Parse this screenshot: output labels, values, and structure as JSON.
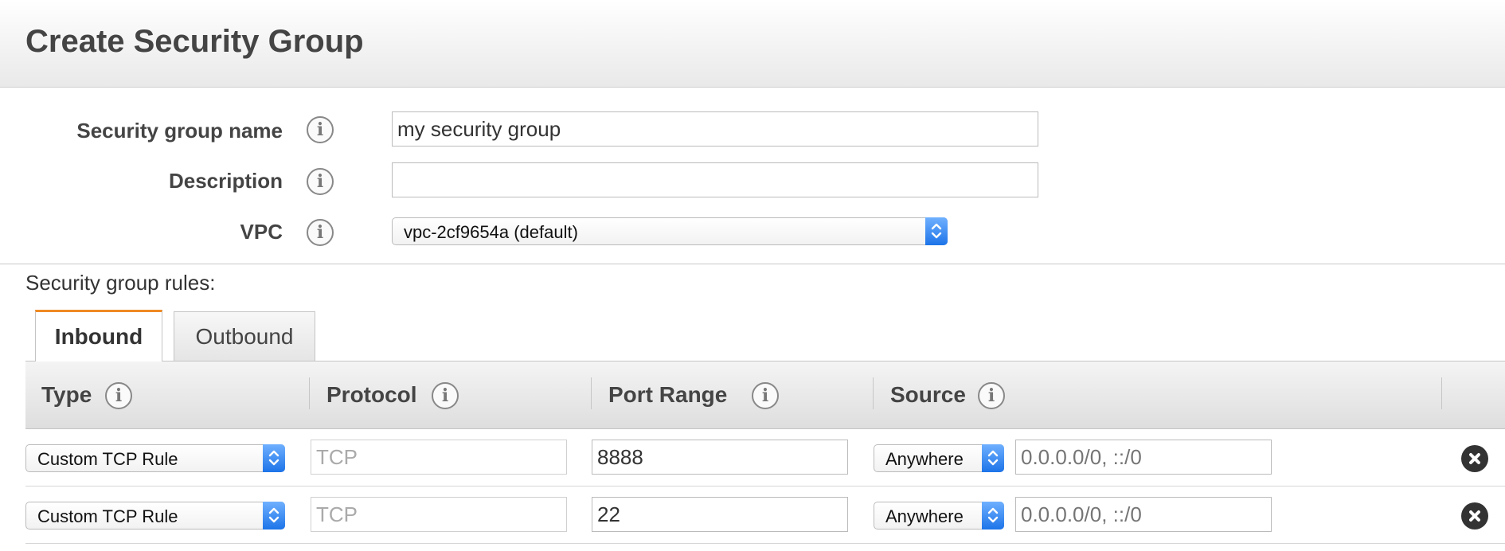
{
  "header": {
    "title": "Create Security Group"
  },
  "form": {
    "name_label": "Security group name",
    "name_value": "my security group",
    "description_label": "Description",
    "description_value": "",
    "vpc_label": "VPC",
    "vpc_value": "vpc-2cf9654a (default)"
  },
  "rules_label": "Security group rules:",
  "tabs": [
    {
      "label": "Inbound",
      "active": true
    },
    {
      "label": "Outbound",
      "active": false
    }
  ],
  "table": {
    "columns": [
      "Type",
      "Protocol",
      "Port Range",
      "Source"
    ],
    "rows": [
      {
        "type": "Custom TCP Rule",
        "protocol": "TCP",
        "port_range": "8888",
        "source": "Anywhere",
        "source_cidr_placeholder": "0.0.0.0/0, ::/0"
      },
      {
        "type": "Custom TCP Rule",
        "protocol": "TCP",
        "port_range": "22",
        "source": "Anywhere",
        "source_cidr_placeholder": "0.0.0.0/0, ::/0"
      }
    ]
  },
  "icons": {
    "info": "info-circle-icon",
    "dropdown": "chevron-up-down-icon",
    "delete": "close-circle-icon"
  },
  "colors": {
    "active_tab_accent": "#f08a24",
    "select_arrow": "#1d74e8"
  }
}
